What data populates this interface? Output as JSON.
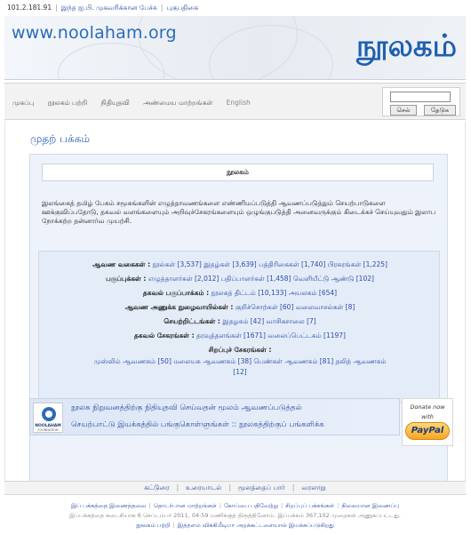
{
  "topbar": {
    "ip": "101.2.181.91",
    "link1": "இந்த ஐ.பி. முகவரிக்கான பேச்சு",
    "link2": "புகுபதிகை"
  },
  "banner": {
    "url": "www.noolaham.org",
    "logo": "நூலகம்"
  },
  "nav": {
    "items": [
      "முகப்பு",
      "நூலகம் பற்றி",
      "நிதியுதவி",
      "அண்மைய மாற்றங்கள்",
      "English"
    ]
  },
  "search": {
    "placeholder": "",
    "go_label": "செல்",
    "search_label": "தேடுக"
  },
  "main": {
    "title": "முதற் பக்கம்",
    "box_heading": "நூலகம்",
    "intro": "இலங்கைத் தமிழ் பேசும் சமூகங்களின் எழுத்தாவணங்களை எண்ணிமப்படுத்தி ஆவணப்படுத்தும் செயற்பாடுகளை ஊக்குவிப்பதோடு, தகவல் வளங்களையும் அறிவுச்சேகரங்களையும் ஒழுங்குபடுத்தி அனைவருக்கும் கிடைக்கச் செய்யுவதும் இலாப நோக்கற்ற தன்னார்வ முயற்சி."
  },
  "categories": [
    {
      "label": "ஆவண வகைகள் :",
      "value": "நூல்கள் [3,537]  இதழ்கள் [3,639]  பத்திரிகைகள் [1,740]  பிரசுரங்கள் [1,225]"
    },
    {
      "label": "பகுப்புக்கள் :",
      "value": "எழுத்தாளர்கள் [2,012]  பதிப்பாளர்கள் [1,458]  வெளியீட்டு ஆண்டு [102]"
    },
    {
      "label": "தகவல் பகுப்பாக்கம் :",
      "value": "நூலகத் திட்டம் [10,133]  அயலகம் [654]"
    },
    {
      "label": "ஆவண அணுக்க நுழைவாயில்கள் :",
      "value": "குறிச்சொற்கள் [60]  வலைவாசல்கள் [8]"
    },
    {
      "label": "செயற்றிட்டங்கள் :",
      "value": "இதழகம் [42]  வாசிகசாலை [7]"
    },
    {
      "label": "தகவல் சேகரங்கள் :",
      "value": "தரவுத்தளங்கள் [1671]  வலைப்பெட்டகம் [1197]"
    },
    {
      "label": "சிறப்புச் சேகரங்கள் :",
      "value": ""
    },
    {
      "label": "",
      "value": "முஸ்லிம் ஆவணகம் [50]  மலையக ஆவணகம் [38]  பெண்கள் ஆவணகம் [81]  தலித் ஆவணகம்"
    },
    {
      "label": "",
      "value": "[12]"
    }
  ],
  "donate": {
    "line1": "நூலக நிறுவனத்திற்கு நிதியுதவி செய்வதன் மூலம் ஆவணப்படுத்தல்",
    "line2": "செயற்பாட்டு இயக்கத்தில் பங்குகொள்ளுங்கள் :: நூலகத்திற்குப் பங்களிக்க",
    "logo_name": "NOOLAHAM",
    "logo_sub": "FOUNDATION",
    "paypal_line1": "Donate now",
    "paypal_line2": "with",
    "paypal_brand": "PayPal"
  },
  "bottom_nav": {
    "items": [
      "கட்டுரை",
      "உரையாடல்",
      "மூலத்தைப் பார்",
      "வரலாறு"
    ]
  },
  "footer": {
    "links": [
      "இப் பக்கத்தை இணைத்தவை",
      "தொடர்பான மாற்றங்கள்",
      "கோப்பை பதிவேற்று",
      "சிறப்புப் பக்கங்கள்",
      "நிலையான இணைப்பு"
    ],
    "info": "இப்பக்கத்தை கடைசியாக 6 செப்டம்பர் 2011, 04:59 மணிக்குத் திருத்தினோம். இப்பக்கம் 367,102 முறைகள் அணுகப்பட்டது.",
    "bottom": [
      "நூலகம் பற்றி",
      "இத்தளம் விக்கிமீடியா அறக்கட்டளையால் இயக்கப்படுகிறது"
    ]
  },
  "colors": {
    "accent": "#2a5fb4",
    "link": "#2a4fa8",
    "box_bg": "#eef3fb",
    "category_bg": "#e4ecf8"
  }
}
